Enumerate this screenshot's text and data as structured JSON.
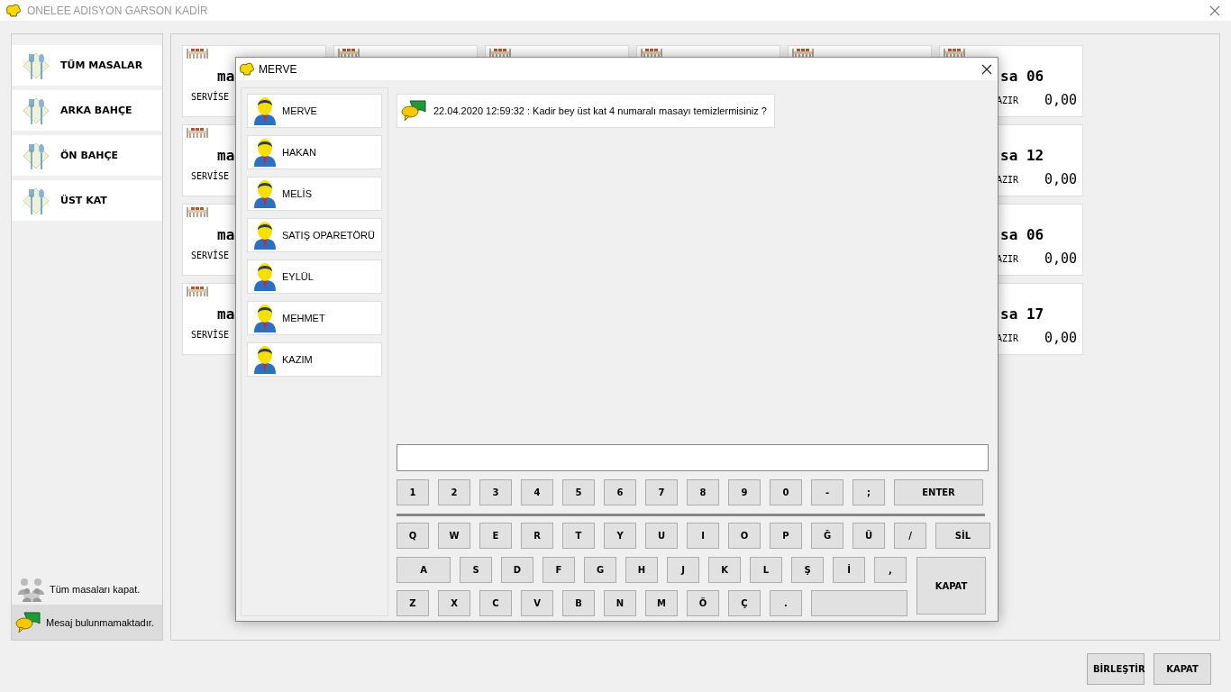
{
  "window": {
    "title": "ONELEE ADISYON GARSON KADİR"
  },
  "categories": [
    {
      "label": "TÜM MASALAR"
    },
    {
      "label": "ARKA BAHÇE"
    },
    {
      "label": "ÖN BAHÇE"
    },
    {
      "label": "ÜST KAT"
    }
  ],
  "sidebar_footer": {
    "close_all": "Tüm masaları kapat.",
    "message_status": "Mesaj bulunmamaktadır."
  },
  "tables": [
    [
      {
        "kind": "left",
        "name": "ma",
        "status": "SERVİSE"
      },
      {
        "kind": "covered"
      },
      {
        "kind": "covered"
      },
      {
        "kind": "covered"
      },
      {
        "kind": "covered"
      },
      {
        "kind": "right_with_icon",
        "name": "sa 06",
        "status": "AZIR",
        "amount": "0,00"
      }
    ],
    [
      {
        "kind": "left",
        "name": "ma",
        "status": "SERVİSE"
      },
      {
        "kind": "right",
        "name": "sa 12",
        "status": "AZIR",
        "amount": "0,00"
      }
    ],
    [
      {
        "kind": "left",
        "name": "ma",
        "status": "SERVİSE"
      },
      {
        "kind": "right",
        "name": "sa 06",
        "status": "AZIR",
        "amount": "0,00"
      }
    ],
    [
      {
        "kind": "left",
        "name": "ma",
        "status": "SERVİSE"
      },
      {
        "kind": "right",
        "name": "sa 17",
        "status": "AZIR",
        "amount": "0,00"
      }
    ]
  ],
  "dialog": {
    "title": "MERVE",
    "users": [
      "MERVE",
      "HAKAN",
      "MELİS",
      "SATIŞ OPARETÖRÜ",
      "EYLÜL",
      "MEHMET",
      "KAZIM"
    ],
    "messages": [
      "22.04.2020 12:59:32 : Kadir bey üst kat 4 numaralı masayı temizlermisiniz ?"
    ],
    "keyboard": {
      "top_row": [
        {
          "kind": "key",
          "label": "1"
        },
        {
          "kind": "key",
          "label": "2"
        },
        {
          "kind": "key",
          "label": "3"
        },
        {
          "kind": "key",
          "label": "4"
        },
        {
          "kind": "key",
          "label": "5"
        },
        {
          "kind": "key",
          "label": "6"
        },
        {
          "kind": "key",
          "label": "7"
        },
        {
          "kind": "key",
          "label": "8"
        },
        {
          "kind": "key",
          "label": "9"
        },
        {
          "kind": "key",
          "label": "0"
        },
        {
          "kind": "key",
          "label": "-"
        },
        {
          "kind": "key",
          "label": ";"
        },
        {
          "kind": "enter",
          "label": "ENTER"
        }
      ],
      "rows": [
        [
          {
            "kind": "key",
            "label": "Q"
          },
          {
            "kind": "key",
            "label": "W"
          },
          {
            "kind": "key",
            "label": "E"
          },
          {
            "kind": "key",
            "label": "R"
          },
          {
            "kind": "key",
            "label": "T"
          },
          {
            "kind": "key",
            "label": "Y"
          },
          {
            "kind": "key",
            "label": "U"
          },
          {
            "kind": "key",
            "label": "I"
          },
          {
            "kind": "key",
            "label": "O"
          },
          {
            "kind": "key",
            "label": "P"
          },
          {
            "kind": "key",
            "label": "Ğ"
          },
          {
            "kind": "key",
            "label": "Ü"
          },
          {
            "kind": "key",
            "label": "/"
          },
          {
            "kind": "delete",
            "label": "SİL"
          }
        ],
        [
          {
            "kind": "wide",
            "label": "A"
          },
          {
            "kind": "key",
            "label": "S"
          },
          {
            "kind": "key",
            "label": "D"
          },
          {
            "kind": "key",
            "label": "F"
          },
          {
            "kind": "key",
            "label": "G"
          },
          {
            "kind": "key",
            "label": "H"
          },
          {
            "kind": "key",
            "label": "J"
          },
          {
            "kind": "key",
            "label": "K"
          },
          {
            "kind": "key",
            "label": "L"
          },
          {
            "kind": "key",
            "label": "Ş"
          },
          {
            "kind": "key",
            "label": "İ"
          },
          {
            "kind": "key",
            "label": ","
          }
        ],
        [
          {
            "kind": "key",
            "label": "Z"
          },
          {
            "kind": "key",
            "label": "X"
          },
          {
            "kind": "key",
            "label": "C"
          },
          {
            "kind": "key",
            "label": "V"
          },
          {
            "kind": "key",
            "label": "B"
          },
          {
            "kind": "key",
            "label": "N"
          },
          {
            "kind": "key",
            "label": "M"
          },
          {
            "kind": "key",
            "label": "Ö"
          },
          {
            "kind": "key",
            "label": "Ç"
          },
          {
            "kind": "key",
            "label": "."
          },
          {
            "kind": "space"
          }
        ]
      ],
      "close_key": "KAPAT"
    }
  },
  "buttons": [
    "BİRLEŞTİR",
    "KAPAT"
  ]
}
